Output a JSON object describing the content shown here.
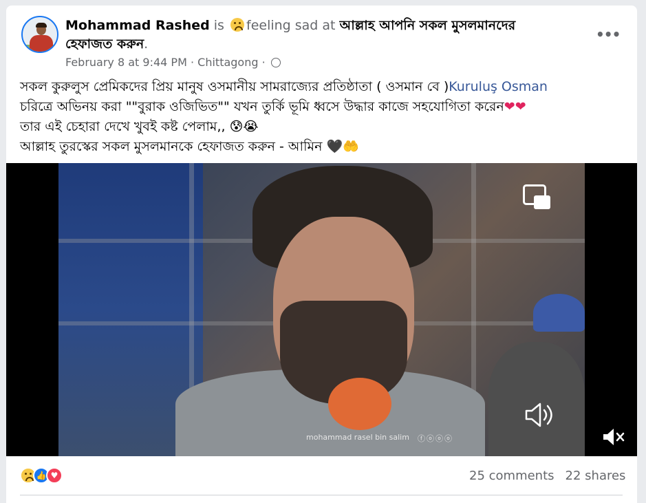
{
  "post": {
    "author": "Mohammad Rashed",
    "is_text": "is",
    "feeling_text": "feeling sad at",
    "place": "আল্লাহ আপনি সকল মুসলমানদের হেফাজত করুন",
    "place_end": ".",
    "date": "February 8 at 9:44 PM",
    "location_sep": " · ",
    "location": "Chittagong",
    "privacy_sep": " ·",
    "more_label": "•••",
    "body": {
      "line1_text": "সকল কুরুলুস প্রেমিকদের প্রিয় মানুষ ওসমানীয় সামরাজ্যের প্রতিষ্ঠাতা ( ওসমান বে )",
      "line1_link": "Kuruluş Osman",
      "line2_text": "চরিত্রে অভিনয় করা \"\"বুরাক ওজিভিত\"\" যখন তুর্কি ভূমি ধ্বসে উদ্ধার কাজে সহযোগিতা করেন",
      "line2_emoji": "❤❤",
      "line3_text": "তার এই চেহারা দেখে খুবই কষ্ট পেলাম,, ",
      "line3_emoji": "😰😭",
      "line4_text": "আল্লাহ তুরস্কের সকল মুসলমানকে হেফাজত করুন - আমিন ",
      "line4_heart": "🖤",
      "line4_hands": "🤲"
    },
    "video": {
      "watermark": "mohammad rasel bin salim",
      "social_icons": "ⓕⓞⓞⓞ"
    },
    "reactions": [
      "sad",
      "like",
      "love"
    ],
    "reaction_glyphs": {
      "like": "👍",
      "love": "♥"
    },
    "comments": "25 comments",
    "shares": "22 shares"
  },
  "colors": {
    "accent": "#1877f2",
    "link": "#385898",
    "muted": "#65676b",
    "love": "#f33e58"
  }
}
